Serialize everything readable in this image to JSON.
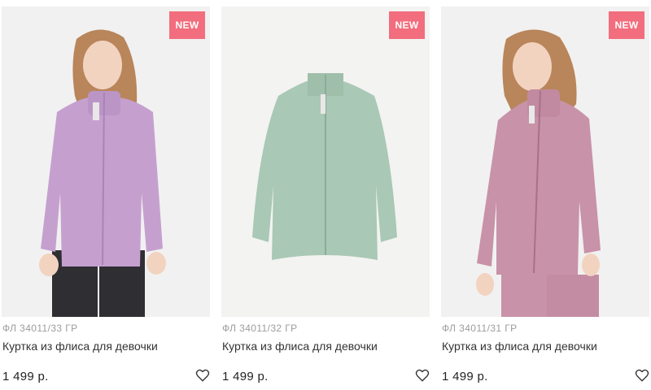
{
  "products": [
    {
      "badge": "NEW",
      "sku": "ФЛ 34011/33 ГР",
      "name": "Куртка из флиса для девочки",
      "price": "1 499 р.",
      "favorite_icon": "heart-outline-icon",
      "jacket_color": "#c5a0cf"
    },
    {
      "badge": "NEW",
      "sku": "ФЛ 34011/32 ГР",
      "name": "Куртка из флиса для девочки",
      "price": "1 499 р.",
      "favorite_icon": "heart-outline-icon",
      "jacket_color": "#a9c8b5"
    },
    {
      "badge": "NEW",
      "sku": "ФЛ 34011/31 ГР",
      "name": "Куртка из флиса для девочки",
      "price": "1 499 р.",
      "favorite_icon": "heart-outline-icon",
      "jacket_color": "#c892a8"
    }
  ],
  "colors": {
    "badge": "#f26d7d",
    "sku": "#9c9c9c",
    "text": "#333333"
  }
}
